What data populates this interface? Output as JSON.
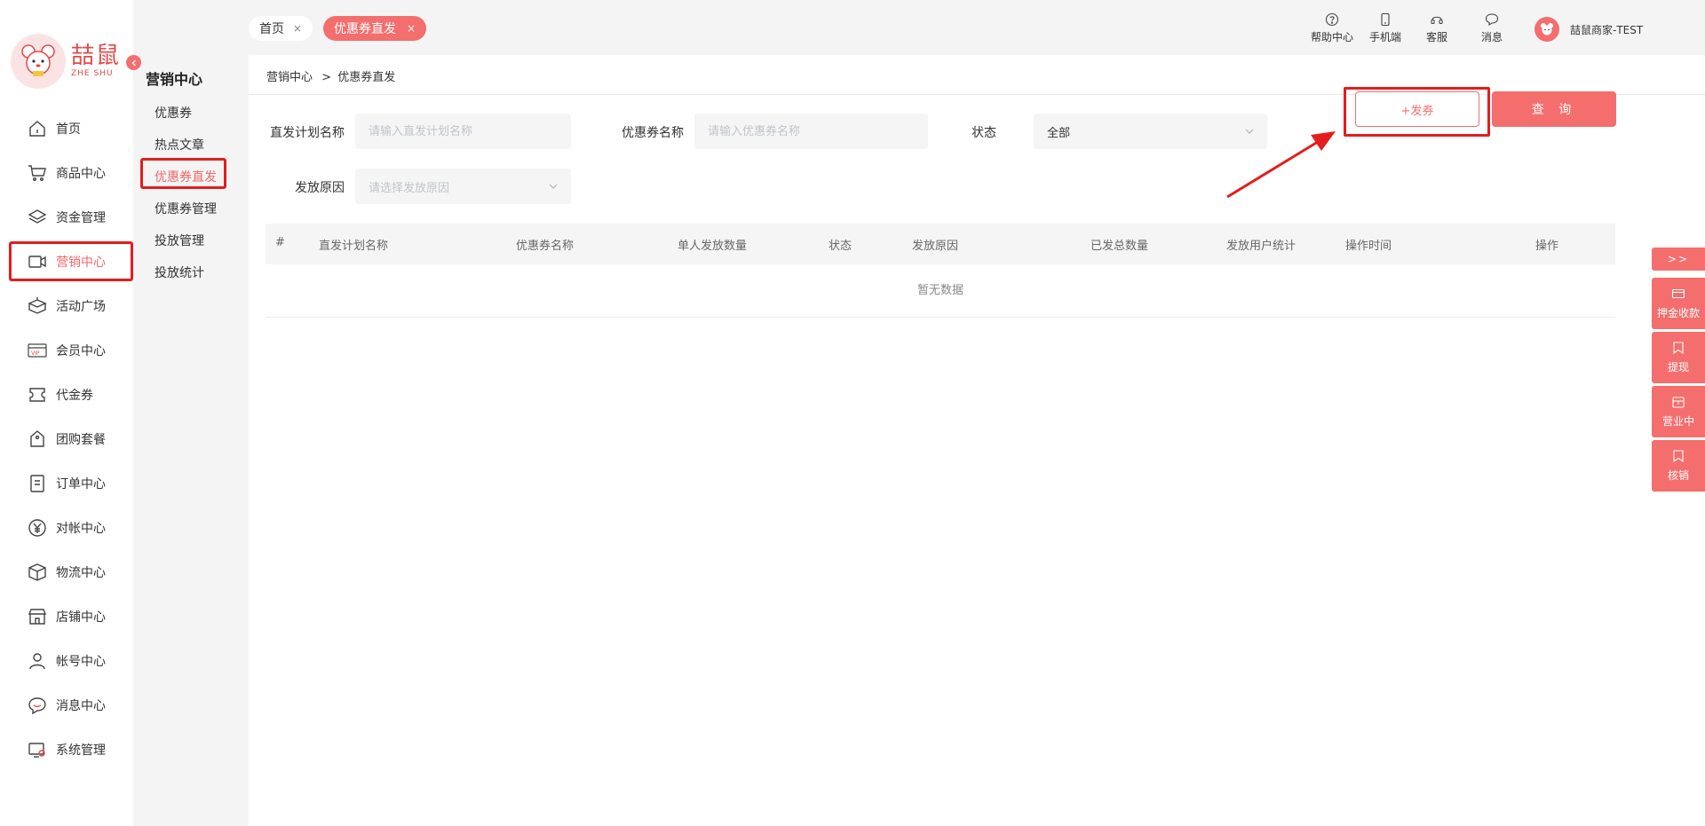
{
  "brand": {
    "name_cn": "喆鼠",
    "name_en": "ZHE SHU"
  },
  "colors": {
    "accent": "#f46e6e",
    "highlight": "#e41d1d"
  },
  "sidebar": {
    "items": [
      {
        "label": "首页",
        "icon": "home-icon"
      },
      {
        "label": "商品中心",
        "icon": "cart-icon"
      },
      {
        "label": "资金管理",
        "icon": "layers-icon"
      },
      {
        "label": "营销中心",
        "icon": "marketing-icon"
      },
      {
        "label": "活动广场",
        "icon": "box-icon"
      },
      {
        "label": "会员中心",
        "icon": "vip-icon"
      },
      {
        "label": "代金券",
        "icon": "ticket-icon"
      },
      {
        "label": "团购套餐",
        "icon": "tag-icon"
      },
      {
        "label": "订单中心",
        "icon": "list-icon"
      },
      {
        "label": "对帐中心",
        "icon": "yen-icon"
      },
      {
        "label": "物流中心",
        "icon": "package-icon"
      },
      {
        "label": "店铺中心",
        "icon": "store-icon"
      },
      {
        "label": "帐号中心",
        "icon": "user-icon"
      },
      {
        "label": "消息中心",
        "icon": "chat-icon"
      },
      {
        "label": "系统管理",
        "icon": "settings-monitor-icon"
      }
    ],
    "active_index": 3
  },
  "subnav": {
    "title": "营销中心",
    "items": [
      {
        "label": "优惠券"
      },
      {
        "label": "热点文章"
      },
      {
        "label": "优惠券直发"
      },
      {
        "label": "优惠券管理"
      },
      {
        "label": "投放管理"
      },
      {
        "label": "投放统计"
      }
    ],
    "active_index": 2
  },
  "header": {
    "tabs": [
      {
        "label": "首页",
        "close": "×"
      },
      {
        "label": "优惠券直发",
        "close": "×"
      }
    ],
    "links": [
      {
        "label": "帮助中心",
        "icon": "help-icon"
      },
      {
        "label": "手机端",
        "icon": "phone-icon"
      },
      {
        "label": "客服",
        "icon": "headset-icon"
      },
      {
        "label": "消息",
        "icon": "message-icon"
      }
    ],
    "user": "喆鼠商家-TEST"
  },
  "breadcrumb": {
    "parent": "营销中心",
    "separator": ">",
    "current": "优惠券直发"
  },
  "filters": {
    "plan_name": {
      "label": "直发计划名称",
      "placeholder": "请输入直发计划名称"
    },
    "coupon_name": {
      "label": "优惠券名称",
      "placeholder": "请输入优惠券名称"
    },
    "status": {
      "label": "状态",
      "value": "全部"
    },
    "reason": {
      "label": "发放原因",
      "placeholder": "请选择发放原因"
    }
  },
  "buttons": {
    "issue": "+发券",
    "query": "查 询"
  },
  "table": {
    "columns": [
      "#",
      "直发计划名称",
      "优惠券名称",
      "单人发放数量",
      "状态",
      "发放原因",
      "已发总数量",
      "发放用户统计",
      "操作时间",
      "操作"
    ],
    "empty_text": "暂无数据"
  },
  "dock": {
    "toggle": ">>",
    "items": [
      {
        "label": "押金收款",
        "icon": "card-icon"
      },
      {
        "label": "提现",
        "icon": "bookmark-icon"
      },
      {
        "label": "营业中",
        "icon": "shop-icon"
      },
      {
        "label": "核销",
        "icon": "verify-icon"
      }
    ]
  }
}
